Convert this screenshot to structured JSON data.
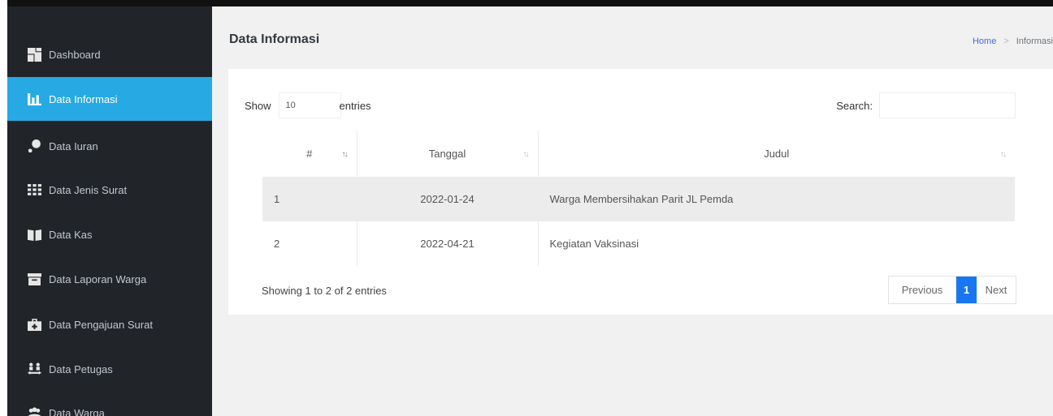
{
  "sidebar": {
    "items": [
      {
        "label": "Dashboard",
        "icon": "dashboard-icon",
        "active": false
      },
      {
        "label": "Data Informasi",
        "icon": "bar-chart-icon",
        "active": true
      },
      {
        "label": "Data Iuran",
        "icon": "donate-icon",
        "active": false
      },
      {
        "label": "Data Jenis Surat",
        "icon": "grid-icon",
        "active": false
      },
      {
        "label": "Data Kas",
        "icon": "book-open-icon",
        "active": false
      },
      {
        "label": "Data Laporan Warga",
        "icon": "archive-icon",
        "active": false
      },
      {
        "label": "Data Pengajuan Surat",
        "icon": "briefcase-medical-icon",
        "active": false
      },
      {
        "label": "Data Petugas",
        "icon": "people-arrows-icon",
        "active": false
      },
      {
        "label": "Data Warga",
        "icon": "users-icon",
        "active": false
      }
    ],
    "active_color": "#27a9e3",
    "bg_color": "#212529"
  },
  "header": {
    "title": "Data Informasi",
    "breadcrumb": {
      "home": "Home",
      "current": "Informasi"
    }
  },
  "table_controls": {
    "show_label": "Show",
    "page_length": "10",
    "entries_label": "entries",
    "search_label": "Search:",
    "search_value": ""
  },
  "table": {
    "columns": [
      "#",
      "Tanggal",
      "Judul"
    ],
    "sort_glyph": "↑↓",
    "rows": [
      {
        "no": "1",
        "tanggal": "2022-01-24",
        "judul": "Warga Membersihakan Parit JL Pemda"
      },
      {
        "no": "2",
        "tanggal": "2022-04-21",
        "judul": "Kegiatan Vaksinasi"
      }
    ]
  },
  "footer": {
    "info": "Showing 1 to 2 of 2 entries",
    "pagination": {
      "previous": "Previous",
      "current": "1",
      "next": "Next"
    }
  },
  "colors": {
    "pager_active": "#1976f2",
    "breadcrumb_link": "#3f6ad8"
  }
}
